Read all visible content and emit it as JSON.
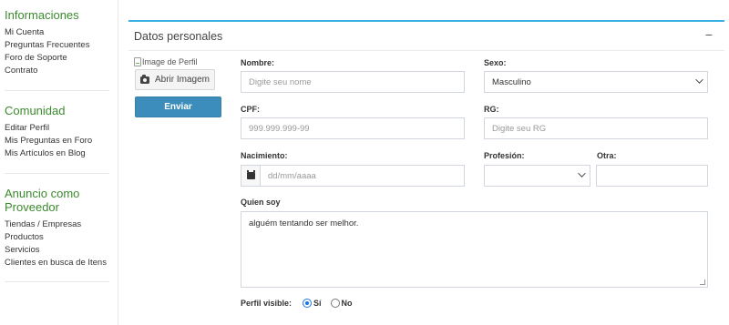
{
  "sidebar": {
    "sections": [
      {
        "title": "Informaciones",
        "items": [
          "Mi Cuenta",
          "Preguntas Frecuentes",
          "Foro de Soporte",
          "Contrato"
        ]
      },
      {
        "title": "Comunidad",
        "items": [
          "Editar Perfil",
          "Mis Preguntas en Foro",
          "Mis Artículos en Blog"
        ]
      },
      {
        "title": "Anuncio como Proveedor",
        "items": [
          "Tiendas / Empresas",
          "Productos",
          "Servicios",
          "Clientes en busca de Itens"
        ]
      }
    ]
  },
  "card": {
    "title": "Datos personales",
    "collapse_label": "−"
  },
  "profile": {
    "image_alt": "Image de Perfil",
    "open_image_label": "Abrir Imagem",
    "send_label": "Enviar"
  },
  "form": {
    "nombre": {
      "label": "Nombre:",
      "placeholder": "Digite seu nome"
    },
    "sexo": {
      "label": "Sexo:",
      "value": "Masculino"
    },
    "cpf": {
      "label": "CPF:",
      "placeholder": "999.999.999-99"
    },
    "rg": {
      "label": "RG:",
      "placeholder": "Digite seu RG"
    },
    "nacimiento": {
      "label": "Nacimiento:",
      "placeholder": "dd/mm/aaaa"
    },
    "profesion": {
      "label": "Profesión:",
      "value": ""
    },
    "otra": {
      "label": "Otra:",
      "value": ""
    },
    "quien_soy": {
      "label": "Quien soy",
      "value": "alguém tentando ser melhor."
    },
    "perfil_visible": {
      "label": "Perfil visible:",
      "options": [
        "Sí",
        "No"
      ],
      "selected": "Sí"
    }
  },
  "colors": {
    "accent_green": "#3b8a2e",
    "card_border": "#3ab1e0",
    "primary_button": "#3c8dbc"
  }
}
